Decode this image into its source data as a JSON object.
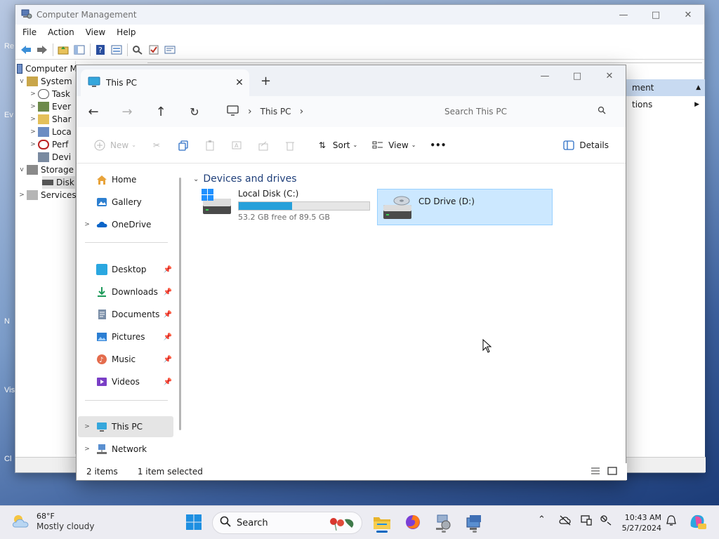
{
  "desktop": {
    "fragments": [
      "Re",
      "Ev",
      "N",
      "Vis",
      "Cl"
    ]
  },
  "cm": {
    "title": "Computer Management",
    "menu": [
      "File",
      "Action",
      "View",
      "Help"
    ],
    "tree": [
      {
        "label": "Computer M",
        "depth": 0,
        "expander": ""
      },
      {
        "label": "System",
        "depth": 1,
        "expander": "v"
      },
      {
        "label": "Task",
        "depth": 2,
        "expander": ">"
      },
      {
        "label": "Ever",
        "depth": 2,
        "expander": ">"
      },
      {
        "label": "Shar",
        "depth": 2,
        "expander": ">"
      },
      {
        "label": "Loca",
        "depth": 2,
        "expander": ">"
      },
      {
        "label": "Perf",
        "depth": 2,
        "expander": ">"
      },
      {
        "label": "Devi",
        "depth": 2,
        "expander": ""
      },
      {
        "label": "Storage",
        "depth": 1,
        "expander": "v"
      },
      {
        "label": "Disk",
        "depth": 2,
        "expander": ""
      },
      {
        "label": "Services",
        "depth": 1,
        "expander": ">"
      }
    ],
    "actions": {
      "header": "ment",
      "row": "tions"
    }
  },
  "explorer": {
    "tab_title": "This PC",
    "address_label": "This PC",
    "search_placeholder": "Search This PC",
    "commands": {
      "new": "New",
      "sort": "Sort",
      "view": "View",
      "more": "•••",
      "details": "Details"
    },
    "nav": {
      "home": "Home",
      "gallery": "Gallery",
      "onedrive": "OneDrive",
      "desktop": "Desktop",
      "downloads": "Downloads",
      "documents": "Documents",
      "pictures": "Pictures",
      "music": "Music",
      "videos": "Videos",
      "thispc": "This PC",
      "network": "Network"
    },
    "group_label": "Devices and drives",
    "drives": [
      {
        "name": "Local Disk (C:)",
        "free": "53.2 GB free of 89.5 GB",
        "used_fraction": 0.406
      },
      {
        "name": "CD Drive (D:)"
      }
    ],
    "status": {
      "count": "2 items",
      "selected": "1 item selected"
    }
  },
  "taskbar": {
    "temp": "68°F",
    "condition": "Mostly cloudy",
    "search_label": "Search",
    "time": "10:43 AM",
    "date": "5/27/2024"
  },
  "colors": {
    "accent": "#0067c0",
    "selection": "#cce8ff",
    "progress": "#26a0da"
  }
}
